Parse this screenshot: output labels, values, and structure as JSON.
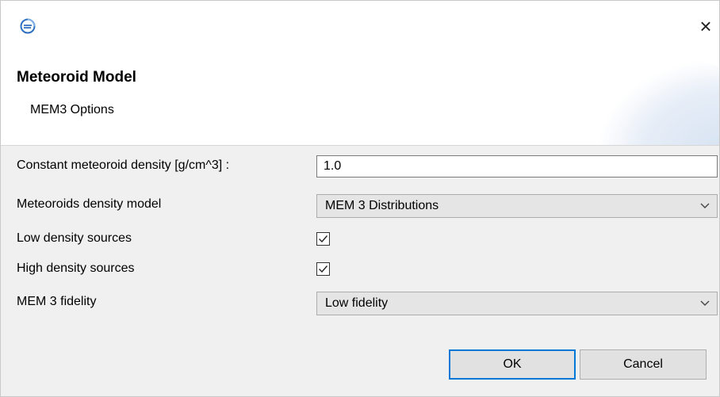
{
  "dialog": {
    "title": "Meteoroid Model",
    "subtitle": "MEM3 Options",
    "close_glyph": "×",
    "app_icon": "eclipse-app-icon"
  },
  "form": {
    "density_label": "Constant meteoroid density [g/cm^3] :",
    "density_value": "1.0",
    "model_label": "Meteoroids density model",
    "model_value": "MEM 3 Distributions",
    "low_label": "Low density sources",
    "low_checked": true,
    "high_label": "High density sources",
    "high_checked": true,
    "fidelity_label": "MEM 3 fidelity",
    "fidelity_value": "Low fidelity"
  },
  "buttons": {
    "ok": "OK",
    "cancel": "Cancel"
  },
  "colors": {
    "accent": "#0078d7",
    "icon_blue": "#2f6fc0"
  }
}
